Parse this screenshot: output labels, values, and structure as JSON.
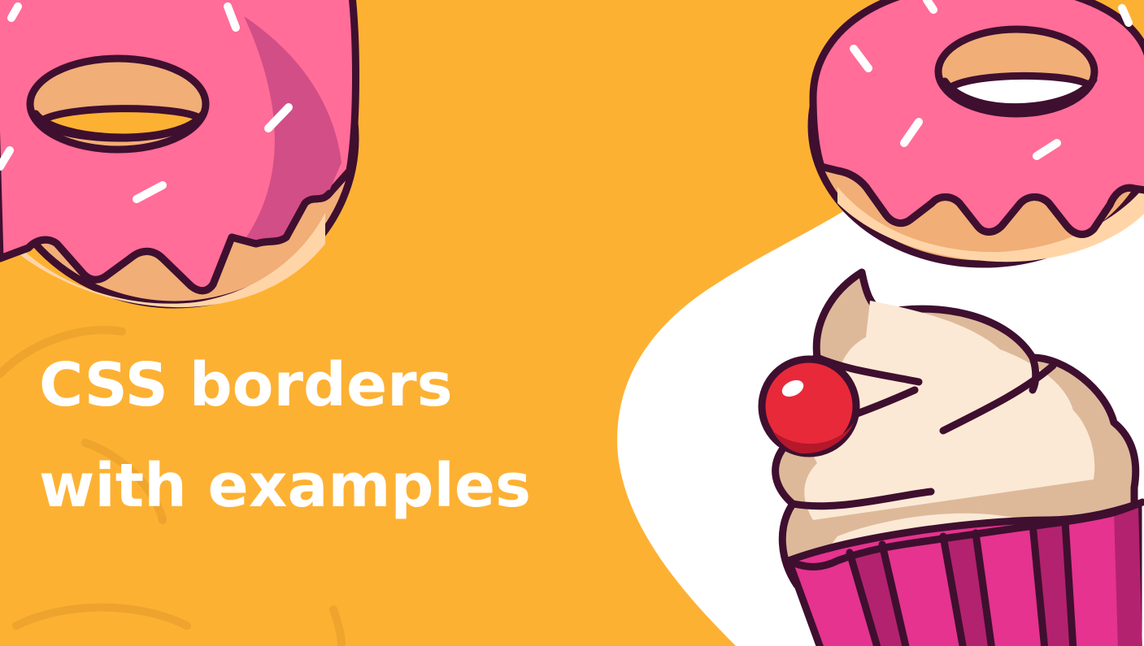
{
  "title": {
    "line1": "CSS borders",
    "line2": "with examples"
  },
  "colors": {
    "background": "#FDB133",
    "title_text": "#FFFFFF",
    "white_wave": "#FFFFFF",
    "outline": "#3F0F2F",
    "icing_pink": "#FF6D98",
    "icing_shadow": "#D24E86",
    "dough": "#F1AE77",
    "dough_light": "#FFD5A8",
    "cream": "#FBE9D5",
    "cream_shadow": "#DDB99A",
    "cup_magenta": "#E5338F",
    "cup_dark": "#B3226F",
    "cherry": "#E8293A"
  },
  "illustration": {
    "items": [
      "donut-icon",
      "donut-icon",
      "cupcake-icon"
    ]
  }
}
